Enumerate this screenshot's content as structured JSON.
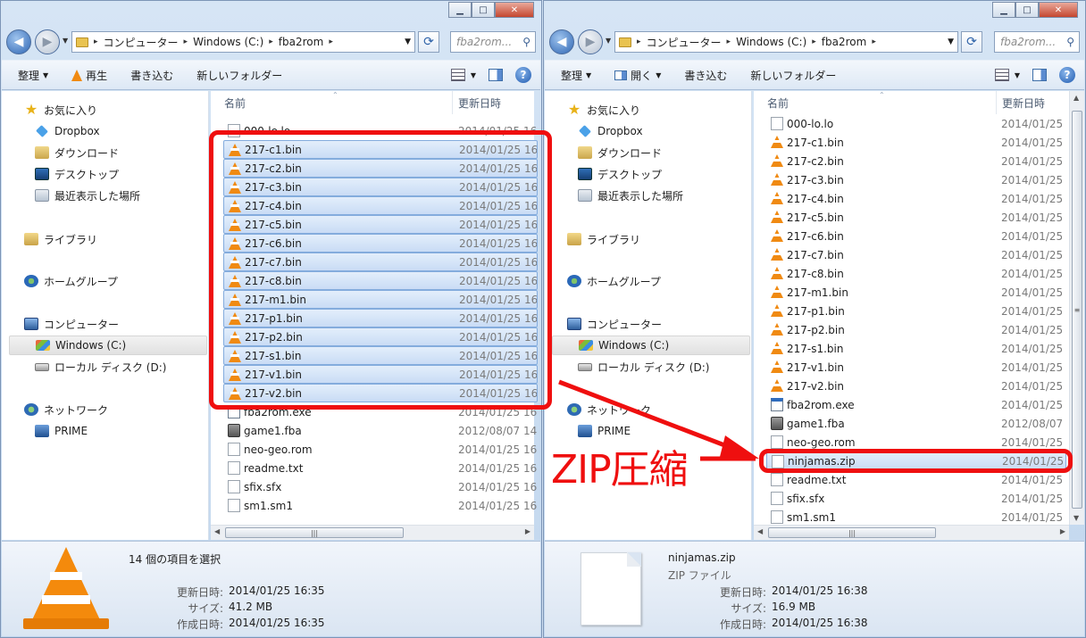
{
  "caption_buttons": {
    "minimize": "▁",
    "maximize": "□",
    "close": "✕"
  },
  "left": {
    "breadcrumb": [
      "コンピューター",
      "Windows (C:)",
      "fba2rom"
    ],
    "search_placeholder": "fba2rom...",
    "toolbar": {
      "organize": "整理",
      "play": "再生",
      "burn": "書き込む",
      "new_folder": "新しいフォルダー"
    },
    "columns": {
      "name": "名前",
      "date": "更新日時"
    },
    "files": [
      {
        "name": "000-lo.lo",
        "date": "2014/01/25 16:",
        "icon": "doc",
        "selected": false
      },
      {
        "name": "217-c1.bin",
        "date": "2014/01/25 16:",
        "icon": "vlc",
        "selected": true
      },
      {
        "name": "217-c2.bin",
        "date": "2014/01/25 16:",
        "icon": "vlc",
        "selected": true
      },
      {
        "name": "217-c3.bin",
        "date": "2014/01/25 16:",
        "icon": "vlc",
        "selected": true
      },
      {
        "name": "217-c4.bin",
        "date": "2014/01/25 16:",
        "icon": "vlc",
        "selected": true
      },
      {
        "name": "217-c5.bin",
        "date": "2014/01/25 16:",
        "icon": "vlc",
        "selected": true
      },
      {
        "name": "217-c6.bin",
        "date": "2014/01/25 16:",
        "icon": "vlc",
        "selected": true
      },
      {
        "name": "217-c7.bin",
        "date": "2014/01/25 16:",
        "icon": "vlc",
        "selected": true
      },
      {
        "name": "217-c8.bin",
        "date": "2014/01/25 16:",
        "icon": "vlc",
        "selected": true
      },
      {
        "name": "217-m1.bin",
        "date": "2014/01/25 16:",
        "icon": "vlc",
        "selected": true
      },
      {
        "name": "217-p1.bin",
        "date": "2014/01/25 16:",
        "icon": "vlc",
        "selected": true
      },
      {
        "name": "217-p2.bin",
        "date": "2014/01/25 16:",
        "icon": "vlc",
        "selected": true
      },
      {
        "name": "217-s1.bin",
        "date": "2014/01/25 16:",
        "icon": "vlc",
        "selected": true
      },
      {
        "name": "217-v1.bin",
        "date": "2014/01/25 16:",
        "icon": "vlc",
        "selected": true
      },
      {
        "name": "217-v2.bin",
        "date": "2014/01/25 16:",
        "icon": "vlc",
        "selected": true
      },
      {
        "name": "fba2rom.exe",
        "date": "2014/01/25 16:",
        "icon": "exe",
        "selected": false
      },
      {
        "name": "game1.fba",
        "date": "2012/08/07 14:",
        "icon": "fba",
        "selected": false
      },
      {
        "name": "neo-geo.rom",
        "date": "2014/01/25 16:",
        "icon": "doc",
        "selected": false
      },
      {
        "name": "readme.txt",
        "date": "2014/01/25 16:",
        "icon": "doc",
        "selected": false
      },
      {
        "name": "sfix.sfx",
        "date": "2014/01/25 16:",
        "icon": "doc",
        "selected": false
      },
      {
        "name": "sm1.sm1",
        "date": "2014/01/25 16:",
        "icon": "doc",
        "selected": false
      }
    ],
    "details": {
      "summary": "14 個の項目を選択",
      "modified_label": "更新日時:",
      "modified": "2014/01/25 16:35",
      "size_label": "サイズ:",
      "size": "41.2 MB",
      "created_label": "作成日時:",
      "created": "2014/01/25 16:35"
    }
  },
  "right": {
    "breadcrumb": [
      "コンピューター",
      "Windows (C:)",
      "fba2rom"
    ],
    "search_placeholder": "fba2rom...",
    "toolbar": {
      "organize": "整理",
      "open": "開く",
      "burn": "書き込む",
      "new_folder": "新しいフォルダー"
    },
    "columns": {
      "name": "名前",
      "date": "更新日時"
    },
    "files": [
      {
        "name": "000-lo.lo",
        "date": "2014/01/25",
        "icon": "doc",
        "selected": false
      },
      {
        "name": "217-c1.bin",
        "date": "2014/01/25",
        "icon": "vlc",
        "selected": false
      },
      {
        "name": "217-c2.bin",
        "date": "2014/01/25",
        "icon": "vlc",
        "selected": false
      },
      {
        "name": "217-c3.bin",
        "date": "2014/01/25",
        "icon": "vlc",
        "selected": false
      },
      {
        "name": "217-c4.bin",
        "date": "2014/01/25",
        "icon": "vlc",
        "selected": false
      },
      {
        "name": "217-c5.bin",
        "date": "2014/01/25",
        "icon": "vlc",
        "selected": false
      },
      {
        "name": "217-c6.bin",
        "date": "2014/01/25",
        "icon": "vlc",
        "selected": false
      },
      {
        "name": "217-c7.bin",
        "date": "2014/01/25",
        "icon": "vlc",
        "selected": false
      },
      {
        "name": "217-c8.bin",
        "date": "2014/01/25",
        "icon": "vlc",
        "selected": false
      },
      {
        "name": "217-m1.bin",
        "date": "2014/01/25",
        "icon": "vlc",
        "selected": false
      },
      {
        "name": "217-p1.bin",
        "date": "2014/01/25",
        "icon": "vlc",
        "selected": false
      },
      {
        "name": "217-p2.bin",
        "date": "2014/01/25",
        "icon": "vlc",
        "selected": false
      },
      {
        "name": "217-s1.bin",
        "date": "2014/01/25",
        "icon": "vlc",
        "selected": false
      },
      {
        "name": "217-v1.bin",
        "date": "2014/01/25",
        "icon": "vlc",
        "selected": false
      },
      {
        "name": "217-v2.bin",
        "date": "2014/01/25",
        "icon": "vlc",
        "selected": false
      },
      {
        "name": "fba2rom.exe",
        "date": "2014/01/25",
        "icon": "exe",
        "selected": false
      },
      {
        "name": "game1.fba",
        "date": "2012/08/07",
        "icon": "fba",
        "selected": false
      },
      {
        "name": "neo-geo.rom",
        "date": "2014/01/25",
        "icon": "doc",
        "selected": false
      },
      {
        "name": "ninjamas.zip",
        "date": "2014/01/25",
        "icon": "zip",
        "selected": true
      },
      {
        "name": "readme.txt",
        "date": "2014/01/25",
        "icon": "doc",
        "selected": false
      },
      {
        "name": "sfix.sfx",
        "date": "2014/01/25",
        "icon": "doc",
        "selected": false
      },
      {
        "name": "sm1.sm1",
        "date": "2014/01/25",
        "icon": "doc",
        "selected": false
      }
    ],
    "details": {
      "name": "ninjamas.zip",
      "type": "ZIP ファイル",
      "modified_label": "更新日時:",
      "modified": "2014/01/25 16:38",
      "size_label": "サイズ:",
      "size": "16.9 MB",
      "created_label": "作成日時:",
      "created": "2014/01/25 16:38"
    }
  },
  "nav": {
    "favorites": "お気に入り",
    "dropbox": "Dropbox",
    "downloads": "ダウンロード",
    "desktop": "デスクトップ",
    "recent": "最近表示した場所",
    "libraries": "ライブラリ",
    "homegroup": "ホームグループ",
    "computer": "コンピューター",
    "drive_c": "Windows (C:)",
    "drive_d": "ローカル ディスク (D:)",
    "network": "ネットワーク",
    "prime": "PRIME"
  },
  "annotation": {
    "label": "ZIP圧縮",
    "color": "#ef0f0f"
  }
}
